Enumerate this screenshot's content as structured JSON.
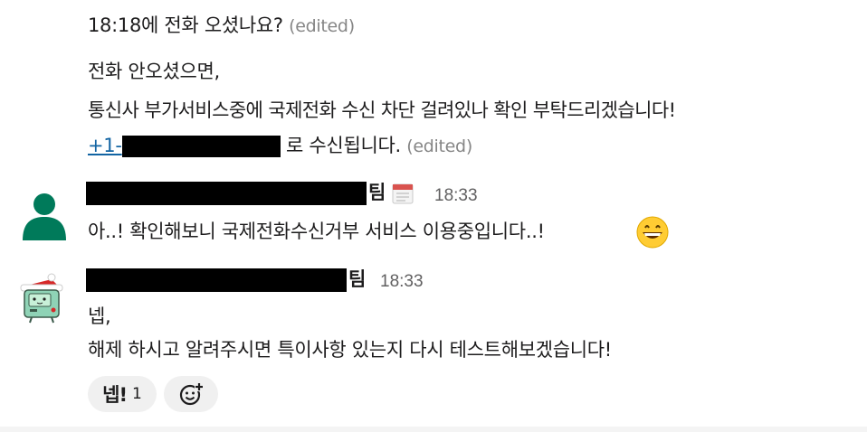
{
  "message1": {
    "line1": "18:18에 전화 오셨나요?",
    "line1_edited": "(edited)",
    "line2": "전화 안오셨으면,",
    "line3": "통신사 부가서비스중에 국제전화 수신 차단 걸려있나 확인 부탁드리겠습니다!",
    "phone_prefix": "+1-",
    "line4": " 로 수신됩니다.",
    "line4_edited": "(edited)"
  },
  "message2": {
    "sender_suffix": "팀",
    "status_icon": "calendar-icon",
    "time": "18:33",
    "text": "아..! 확인해보니 국제전화수신거부 서비스 이용중입니다..!",
    "emoji": "grinning-face"
  },
  "message3": {
    "sender_suffix": "팀",
    "time": "18:33",
    "line1": "넵,",
    "line2": "해제 하시고 알려주시면 특이사항 있는지 다시 테스트해보겠습니다!"
  },
  "reactions": {
    "reaction1_label": "넵!",
    "reaction1_count": "1",
    "add_reaction_icon": "add-emoji-icon"
  },
  "colors": {
    "link": "#1264a3",
    "edited": "#868686",
    "avatar_green": "#007a5a",
    "reaction_bg": "#f0f0f0"
  }
}
